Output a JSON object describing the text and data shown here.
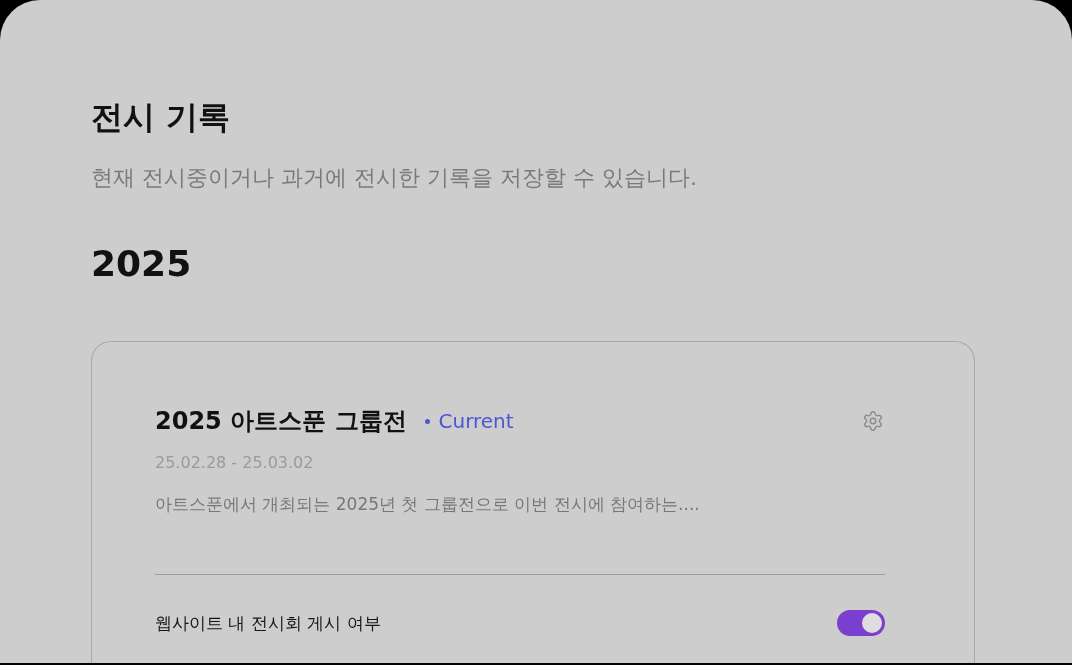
{
  "page": {
    "title": "전시 기록",
    "subtitle": "현재 전시중이거나 과거에 전시한 기록을 저장할 수 있습니다."
  },
  "years": [
    {
      "year": "2025",
      "exhibitions": [
        {
          "title": "2025 아트스푼 그룹전",
          "status": "Current",
          "dates": "25.02.28 - 25.03.02",
          "description": "아트스푼에서 개최되는 2025년 첫 그룹전으로 이번 전시에 참여하는....",
          "publish": {
            "label": "웹사이트 내 전시회 게시 여부",
            "on": true
          }
        }
      ]
    }
  ]
}
